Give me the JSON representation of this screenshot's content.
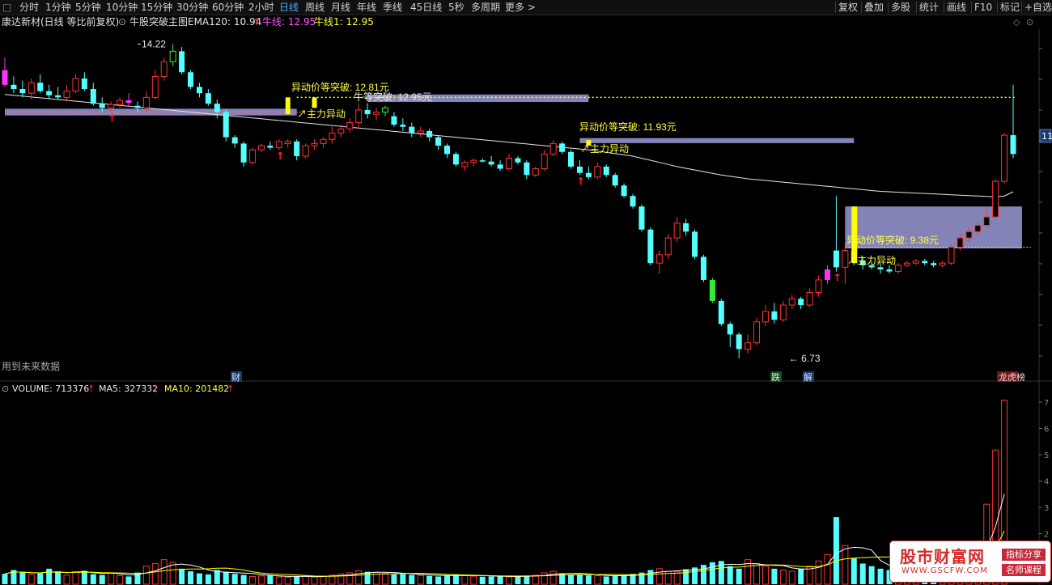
{
  "toolbar": {
    "periods": [
      "分时",
      "1分钟",
      "5分钟",
      "10分钟",
      "15分钟",
      "30分钟",
      "60分钟",
      "2小时",
      "日线",
      "周线",
      "月线",
      "年线",
      "季线",
      "45日线",
      "5秒",
      "多周期",
      "更多 >"
    ],
    "active_period": "日线",
    "tools": [
      "复权",
      "叠加",
      "多股",
      "统计",
      "画线",
      "F10",
      "标记",
      "+自选"
    ]
  },
  "info": {
    "stock": "康达新材(日线 等比前复权)",
    "indicator": "牛股突破主图",
    "ema_label": "EMA120: 10.94",
    "niu_label": "牛线: 12.95",
    "niu1_label": "牛线1: 12.95"
  },
  "annotations": {
    "high": "14.22",
    "low": "6.73",
    "break1": "异动价等突破: 12.81元",
    "break2": "牛等突破: 12.95元",
    "break3": "异动价等突破: 11.93元",
    "break4": "异动价等突破: 9.38元",
    "main1": "主力异动",
    "main2": "主力异动",
    "main3": "主力异动",
    "future": "用到未来数据",
    "tag_cai": "财",
    "tag_die": "跌",
    "tag_jie": "解",
    "tag_bang": "龙虎榜",
    "right_axis": "11"
  },
  "volume": {
    "vol_label": "VOLUME: 713376",
    "ma5_label": "MA5: 327332",
    "ma10_label": "MA10: 201482",
    "axis_ticks": [
      "7",
      "6",
      "5",
      "4",
      "3",
      "2"
    ]
  },
  "watermark": {
    "title": "股市财富网",
    "url": "WWW.GSCFW.COM",
    "tag1": "指标分享",
    "tag2": "名师课程"
  },
  "colors": {
    "up": "#ff3232",
    "down": "#54ffff",
    "ema": "#e6e6e6",
    "niu": "#ffff00",
    "band": "#9a9ad8",
    "label": "#ffff44",
    "ma5": "#ffffff",
    "ma10": "#ffff00"
  },
  "chart_data": {
    "type": "candlestick",
    "series_ohlc": [
      {
        "o": 13.6,
        "h": 13.9,
        "l": 13.2,
        "c": 13.25
      },
      {
        "o": 13.25,
        "h": 13.45,
        "l": 13.05,
        "c": 13.15
      },
      {
        "o": 13.15,
        "h": 13.35,
        "l": 12.95,
        "c": 13.05
      },
      {
        "o": 13.05,
        "h": 13.4,
        "l": 12.9,
        "c": 13.3
      },
      {
        "o": 13.3,
        "h": 13.5,
        "l": 13.05,
        "c": 13.1
      },
      {
        "o": 13.1,
        "h": 13.25,
        "l": 12.9,
        "c": 13.0
      },
      {
        "o": 13.0,
        "h": 13.2,
        "l": 12.9,
        "c": 12.95
      },
      {
        "o": 12.95,
        "h": 13.25,
        "l": 12.85,
        "c": 13.1
      },
      {
        "o": 13.1,
        "h": 13.5,
        "l": 13.05,
        "c": 13.4
      },
      {
        "o": 13.4,
        "h": 13.55,
        "l": 13.1,
        "c": 13.15
      },
      {
        "o": 13.15,
        "h": 13.3,
        "l": 12.75,
        "c": 12.8
      },
      {
        "o": 12.8,
        "h": 12.95,
        "l": 12.6,
        "c": 12.7
      },
      {
        "o": 12.7,
        "h": 12.85,
        "l": 12.6,
        "c": 12.78
      },
      {
        "o": 12.78,
        "h": 12.95,
        "l": 12.7,
        "c": 12.88
      },
      {
        "o": 12.88,
        "h": 13.05,
        "l": 12.75,
        "c": 12.82
      },
      {
        "o": 12.75,
        "h": 12.85,
        "l": 12.6,
        "c": 12.7
      },
      {
        "o": 12.7,
        "h": 13.1,
        "l": 12.6,
        "c": 12.95
      },
      {
        "o": 12.95,
        "h": 13.6,
        "l": 12.9,
        "c": 13.45
      },
      {
        "o": 13.45,
        "h": 13.9,
        "l": 13.35,
        "c": 13.8
      },
      {
        "o": 13.8,
        "h": 14.22,
        "l": 13.7,
        "c": 14.05
      },
      {
        "o": 14.05,
        "h": 14.15,
        "l": 13.5,
        "c": 13.55
      },
      {
        "o": 13.55,
        "h": 13.6,
        "l": 13.15,
        "c": 13.2
      },
      {
        "o": 13.2,
        "h": 13.3,
        "l": 12.95,
        "c": 13.05
      },
      {
        "o": 13.05,
        "h": 13.15,
        "l": 12.75,
        "c": 12.8
      },
      {
        "o": 12.8,
        "h": 12.9,
        "l": 12.45,
        "c": 12.6
      },
      {
        "o": 12.6,
        "h": 12.65,
        "l": 11.9,
        "c": 12.0
      },
      {
        "o": 12.0,
        "h": 12.05,
        "l": 11.75,
        "c": 11.85
      },
      {
        "o": 11.85,
        "h": 11.9,
        "l": 11.3,
        "c": 11.4
      },
      {
        "o": 11.4,
        "h": 11.75,
        "l": 11.35,
        "c": 11.7
      },
      {
        "o": 11.7,
        "h": 11.85,
        "l": 11.65,
        "c": 11.8
      },
      {
        "o": 11.8,
        "h": 11.9,
        "l": 11.7,
        "c": 11.75
      },
      {
        "o": 11.75,
        "h": 11.95,
        "l": 11.7,
        "c": 11.9
      },
      {
        "o": 11.85,
        "h": 11.95,
        "l": 11.75,
        "c": 11.9
      },
      {
        "o": 11.9,
        "h": 11.95,
        "l": 11.45,
        "c": 11.55
      },
      {
        "o": 11.55,
        "h": 11.85,
        "l": 11.5,
        "c": 11.8
      },
      {
        "o": 11.8,
        "h": 11.95,
        "l": 11.7,
        "c": 11.85
      },
      {
        "o": 11.85,
        "h": 12.0,
        "l": 11.75,
        "c": 11.95
      },
      {
        "o": 11.95,
        "h": 12.25,
        "l": 11.85,
        "c": 12.1
      },
      {
        "o": 12.1,
        "h": 12.3,
        "l": 12.0,
        "c": 12.2
      },
      {
        "o": 12.2,
        "h": 12.45,
        "l": 12.1,
        "c": 12.35
      },
      {
        "o": 12.35,
        "h": 12.8,
        "l": 12.2,
        "c": 12.65
      },
      {
        "o": 12.65,
        "h": 12.81,
        "l": 12.45,
        "c": 12.55
      },
      {
        "o": 12.55,
        "h": 12.7,
        "l": 12.4,
        "c": 12.6
      },
      {
        "o": 12.6,
        "h": 12.75,
        "l": 12.5,
        "c": 12.7
      },
      {
        "o": 12.5,
        "h": 12.6,
        "l": 12.25,
        "c": 12.3
      },
      {
        "o": 12.3,
        "h": 12.45,
        "l": 12.15,
        "c": 12.25
      },
      {
        "o": 12.25,
        "h": 12.35,
        "l": 12.0,
        "c": 12.1
      },
      {
        "o": 12.1,
        "h": 12.25,
        "l": 12.0,
        "c": 12.15
      },
      {
        "o": 12.15,
        "h": 12.2,
        "l": 11.9,
        "c": 12.0
      },
      {
        "o": 12.0,
        "h": 12.05,
        "l": 11.7,
        "c": 11.8
      },
      {
        "o": 11.8,
        "h": 11.85,
        "l": 11.5,
        "c": 11.6
      },
      {
        "o": 11.6,
        "h": 11.65,
        "l": 11.3,
        "c": 11.35
      },
      {
        "o": 11.3,
        "h": 11.45,
        "l": 11.2,
        "c": 11.4
      },
      {
        "o": 11.4,
        "h": 11.5,
        "l": 11.3,
        "c": 11.45
      },
      {
        "o": 11.45,
        "h": 11.5,
        "l": 11.4,
        "c": 11.42
      },
      {
        "o": 11.42,
        "h": 11.55,
        "l": 11.3,
        "c": 11.35
      },
      {
        "o": 11.35,
        "h": 11.45,
        "l": 11.2,
        "c": 11.25
      },
      {
        "o": 11.25,
        "h": 11.6,
        "l": 11.2,
        "c": 11.5
      },
      {
        "o": 11.5,
        "h": 11.55,
        "l": 11.35,
        "c": 11.4
      },
      {
        "o": 11.4,
        "h": 11.45,
        "l": 11.0,
        "c": 11.1
      },
      {
        "o": 11.1,
        "h": 11.3,
        "l": 11.05,
        "c": 11.25
      },
      {
        "o": 11.25,
        "h": 11.7,
        "l": 11.2,
        "c": 11.6
      },
      {
        "o": 11.6,
        "h": 11.93,
        "l": 11.55,
        "c": 11.85
      },
      {
        "o": 11.85,
        "h": 11.9,
        "l": 11.6,
        "c": 11.65
      },
      {
        "o": 11.65,
        "h": 11.7,
        "l": 11.25,
        "c": 11.3
      },
      {
        "o": 11.3,
        "h": 11.45,
        "l": 11.1,
        "c": 11.15
      },
      {
        "o": 11.15,
        "h": 11.3,
        "l": 11.0,
        "c": 11.05
      },
      {
        "o": 11.05,
        "h": 11.4,
        "l": 11.0,
        "c": 11.3
      },
      {
        "o": 11.3,
        "h": 11.35,
        "l": 11.05,
        "c": 11.1
      },
      {
        "o": 11.1,
        "h": 11.15,
        "l": 10.8,
        "c": 10.85
      },
      {
        "o": 10.85,
        "h": 10.9,
        "l": 10.55,
        "c": 10.6
      },
      {
        "o": 10.6,
        "h": 10.65,
        "l": 10.3,
        "c": 10.35
      },
      {
        "o": 10.35,
        "h": 10.4,
        "l": 9.75,
        "c": 9.8
      },
      {
        "o": 9.8,
        "h": 9.85,
        "l": 8.95,
        "c": 9.0
      },
      {
        "o": 9.0,
        "h": 9.3,
        "l": 8.75,
        "c": 9.2
      },
      {
        "o": 9.2,
        "h": 9.7,
        "l": 9.1,
        "c": 9.6
      },
      {
        "o": 9.6,
        "h": 10.1,
        "l": 9.5,
        "c": 9.95
      },
      {
        "o": 9.95,
        "h": 10.05,
        "l": 9.65,
        "c": 9.75
      },
      {
        "o": 9.75,
        "h": 9.8,
        "l": 9.1,
        "c": 9.15
      },
      {
        "o": 9.15,
        "h": 9.2,
        "l": 8.55,
        "c": 8.6
      },
      {
        "o": 8.6,
        "h": 8.65,
        "l": 8.05,
        "c": 8.1
      },
      {
        "o": 8.1,
        "h": 8.15,
        "l": 7.5,
        "c": 7.55
      },
      {
        "o": 7.55,
        "h": 7.6,
        "l": 7.0,
        "c": 7.3
      },
      {
        "o": 7.3,
        "h": 7.35,
        "l": 6.73,
        "c": 6.95
      },
      {
        "o": 6.95,
        "h": 7.3,
        "l": 6.85,
        "c": 7.1
      },
      {
        "o": 7.1,
        "h": 7.7,
        "l": 7.05,
        "c": 7.6
      },
      {
        "o": 7.6,
        "h": 8.0,
        "l": 7.5,
        "c": 7.85
      },
      {
        "o": 7.85,
        "h": 8.05,
        "l": 7.55,
        "c": 7.65
      },
      {
        "o": 7.65,
        "h": 8.1,
        "l": 7.6,
        "c": 8.0
      },
      {
        "o": 8.0,
        "h": 8.25,
        "l": 7.9,
        "c": 8.15
      },
      {
        "o": 8.15,
        "h": 8.2,
        "l": 7.9,
        "c": 8.0
      },
      {
        "o": 8.0,
        "h": 8.4,
        "l": 7.95,
        "c": 8.3
      },
      {
        "o": 8.3,
        "h": 8.7,
        "l": 8.2,
        "c": 8.6
      },
      {
        "o": 8.6,
        "h": 8.95,
        "l": 8.5,
        "c": 8.85
      },
      {
        "o": 9.3,
        "h": 10.6,
        "l": 8.8,
        "c": 8.9
      },
      {
        "o": 8.9,
        "h": 9.5,
        "l": 8.5,
        "c": 9.3
      },
      {
        "o": 9.3,
        "h": 9.4,
        "l": 8.95,
        "c": 9.05
      },
      {
        "o": 9.05,
        "h": 9.15,
        "l": 8.85,
        "c": 8.95
      },
      {
        "o": 8.95,
        "h": 9.05,
        "l": 8.85,
        "c": 8.9
      },
      {
        "o": 8.9,
        "h": 9.0,
        "l": 8.75,
        "c": 8.85
      },
      {
        "o": 8.85,
        "h": 8.95,
        "l": 8.75,
        "c": 8.8
      },
      {
        "o": 8.8,
        "h": 9.0,
        "l": 8.75,
        "c": 8.95
      },
      {
        "o": 8.95,
        "h": 9.05,
        "l": 8.9,
        "c": 9.0
      },
      {
        "o": 9.0,
        "h": 9.1,
        "l": 8.95,
        "c": 9.05
      },
      {
        "o": 9.05,
        "h": 9.1,
        "l": 8.95,
        "c": 9.0
      },
      {
        "o": 9.0,
        "h": 9.05,
        "l": 8.9,
        "c": 8.95
      },
      {
        "o": 8.95,
        "h": 9.05,
        "l": 8.9,
        "c": 9.0
      },
      {
        "o": 9.0,
        "h": 9.45,
        "l": 8.95,
        "c": 9.38
      },
      {
        "o": 9.38,
        "h": 9.7,
        "l": 9.3,
        "c": 9.6
      },
      {
        "o": 9.6,
        "h": 9.85,
        "l": 9.5,
        "c": 9.75
      },
      {
        "o": 9.75,
        "h": 10.0,
        "l": 9.65,
        "c": 9.9
      },
      {
        "o": 9.9,
        "h": 10.3,
        "l": 9.85,
        "c": 10.1
      },
      {
        "o": 10.1,
        "h": 11.0,
        "l": 10.05,
        "c": 10.95
      },
      {
        "o": 10.95,
        "h": 12.1,
        "l": 10.9,
        "c": 12.05
      },
      {
        "o": 12.05,
        "h": 13.25,
        "l": 11.5,
        "c": 11.6
      }
    ],
    "ema120": [
      13.02,
      13.0,
      12.98,
      12.96,
      12.94,
      12.92,
      12.9,
      12.88,
      12.86,
      12.84,
      12.82,
      12.8,
      12.78,
      12.76,
      12.74,
      12.72,
      12.7,
      12.68,
      12.66,
      12.64,
      12.62,
      12.6,
      12.58,
      12.56,
      12.54,
      12.52,
      12.5,
      12.48,
      12.46,
      12.44,
      12.42,
      12.4,
      12.38,
      12.36,
      12.34,
      12.32,
      12.3,
      12.28,
      12.26,
      12.24,
      12.22,
      12.2,
      12.18,
      12.16,
      12.14,
      12.12,
      12.1,
      12.08,
      12.06,
      12.04,
      12.02,
      12.0,
      11.98,
      11.96,
      11.94,
      11.92,
      11.9,
      11.88,
      11.86,
      11.84,
      11.82,
      11.8,
      11.78,
      11.76,
      11.74,
      11.72,
      11.7,
      11.67,
      11.64,
      11.61,
      11.58,
      11.55,
      11.5,
      11.45,
      11.4,
      11.35,
      11.3,
      11.26,
      11.22,
      11.18,
      11.14,
      11.1,
      11.07,
      11.04,
      11.01,
      10.99,
      10.97,
      10.95,
      10.93,
      10.91,
      10.89,
      10.87,
      10.85,
      10.83,
      10.81,
      10.79,
      10.77,
      10.75,
      10.73,
      10.71,
      10.7,
      10.69,
      10.68,
      10.67,
      10.66,
      10.65,
      10.64,
      10.63,
      10.62,
      10.61,
      10.6,
      10.59,
      10.58,
      10.6,
      10.7
    ],
    "niu_line": 12.95,
    "break_levels": [
      12.81,
      11.93,
      9.38
    ],
    "high": 14.22,
    "low": 6.73,
    "volume": [
      40000,
      55000,
      45000,
      38000,
      42000,
      60000,
      50000,
      35000,
      48000,
      52000,
      39000,
      36000,
      42000,
      33000,
      30000,
      45000,
      70000,
      80000,
      95000,
      85000,
      60000,
      50000,
      42000,
      38000,
      55000,
      48000,
      40000,
      36000,
      30000,
      32000,
      34000,
      28000,
      26000,
      30000,
      33000,
      29000,
      31000,
      35000,
      40000,
      44000,
      52000,
      48000,
      46000,
      42000,
      38000,
      40000,
      36000,
      34000,
      32000,
      30000,
      35000,
      38000,
      33000,
      31000,
      29000,
      30000,
      32000,
      28000,
      30000,
      33000,
      35000,
      44000,
      50000,
      42000,
      38000,
      36000,
      34000,
      33000,
      30000,
      32000,
      35000,
      40000,
      45000,
      55000,
      60000,
      50000,
      48000,
      58000,
      65000,
      75000,
      85000,
      90000,
      70000,
      60000,
      95000,
      80000,
      70000,
      60000,
      55000,
      50000,
      60000,
      70000,
      90000,
      115000,
      260000,
      150000,
      100000,
      80000,
      70000,
      60000,
      55000,
      50000,
      45000,
      48000,
      52000,
      55000,
      60000,
      70000,
      80000,
      95000,
      110000,
      310000,
      520000,
      713376
    ],
    "ma5_last": 327332,
    "ma10_last": 201482,
    "price_range": [
      6.4,
      14.5
    ]
  }
}
